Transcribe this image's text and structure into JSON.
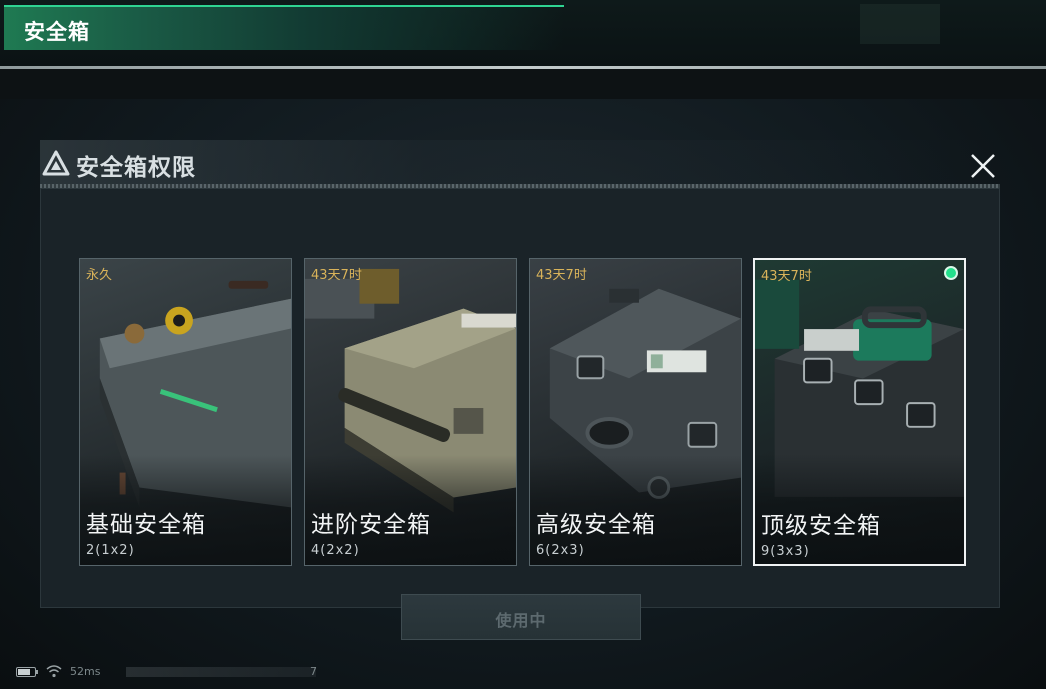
{
  "header": {
    "title": "安全箱"
  },
  "dialog": {
    "title": "安全箱权限",
    "icons": {
      "title_icon": "warning-triangle-icon",
      "close_icon": "close-icon"
    },
    "cards": [
      {
        "duration": "永久",
        "name": "基础安全箱",
        "capacity": "2(1x2)",
        "selected": false
      },
      {
        "duration": "43天7时",
        "name": "进阶安全箱",
        "capacity": "4(2x2)",
        "selected": false
      },
      {
        "duration": "43天7时",
        "name": "高级安全箱",
        "capacity": "6(2x3)",
        "selected": false
      },
      {
        "duration": "43天7时",
        "name": "顶级安全箱",
        "capacity": "9(3x3)",
        "selected": true
      }
    ],
    "action_button": "使用中"
  },
  "status_bar": {
    "ping": "52ms",
    "tail": "7",
    "icons": [
      "battery-icon",
      "wifi-icon"
    ]
  },
  "colors": {
    "accent_green": "#23e08c",
    "duration_gold": "#d9b35a",
    "header_green": "#1f7a52"
  }
}
